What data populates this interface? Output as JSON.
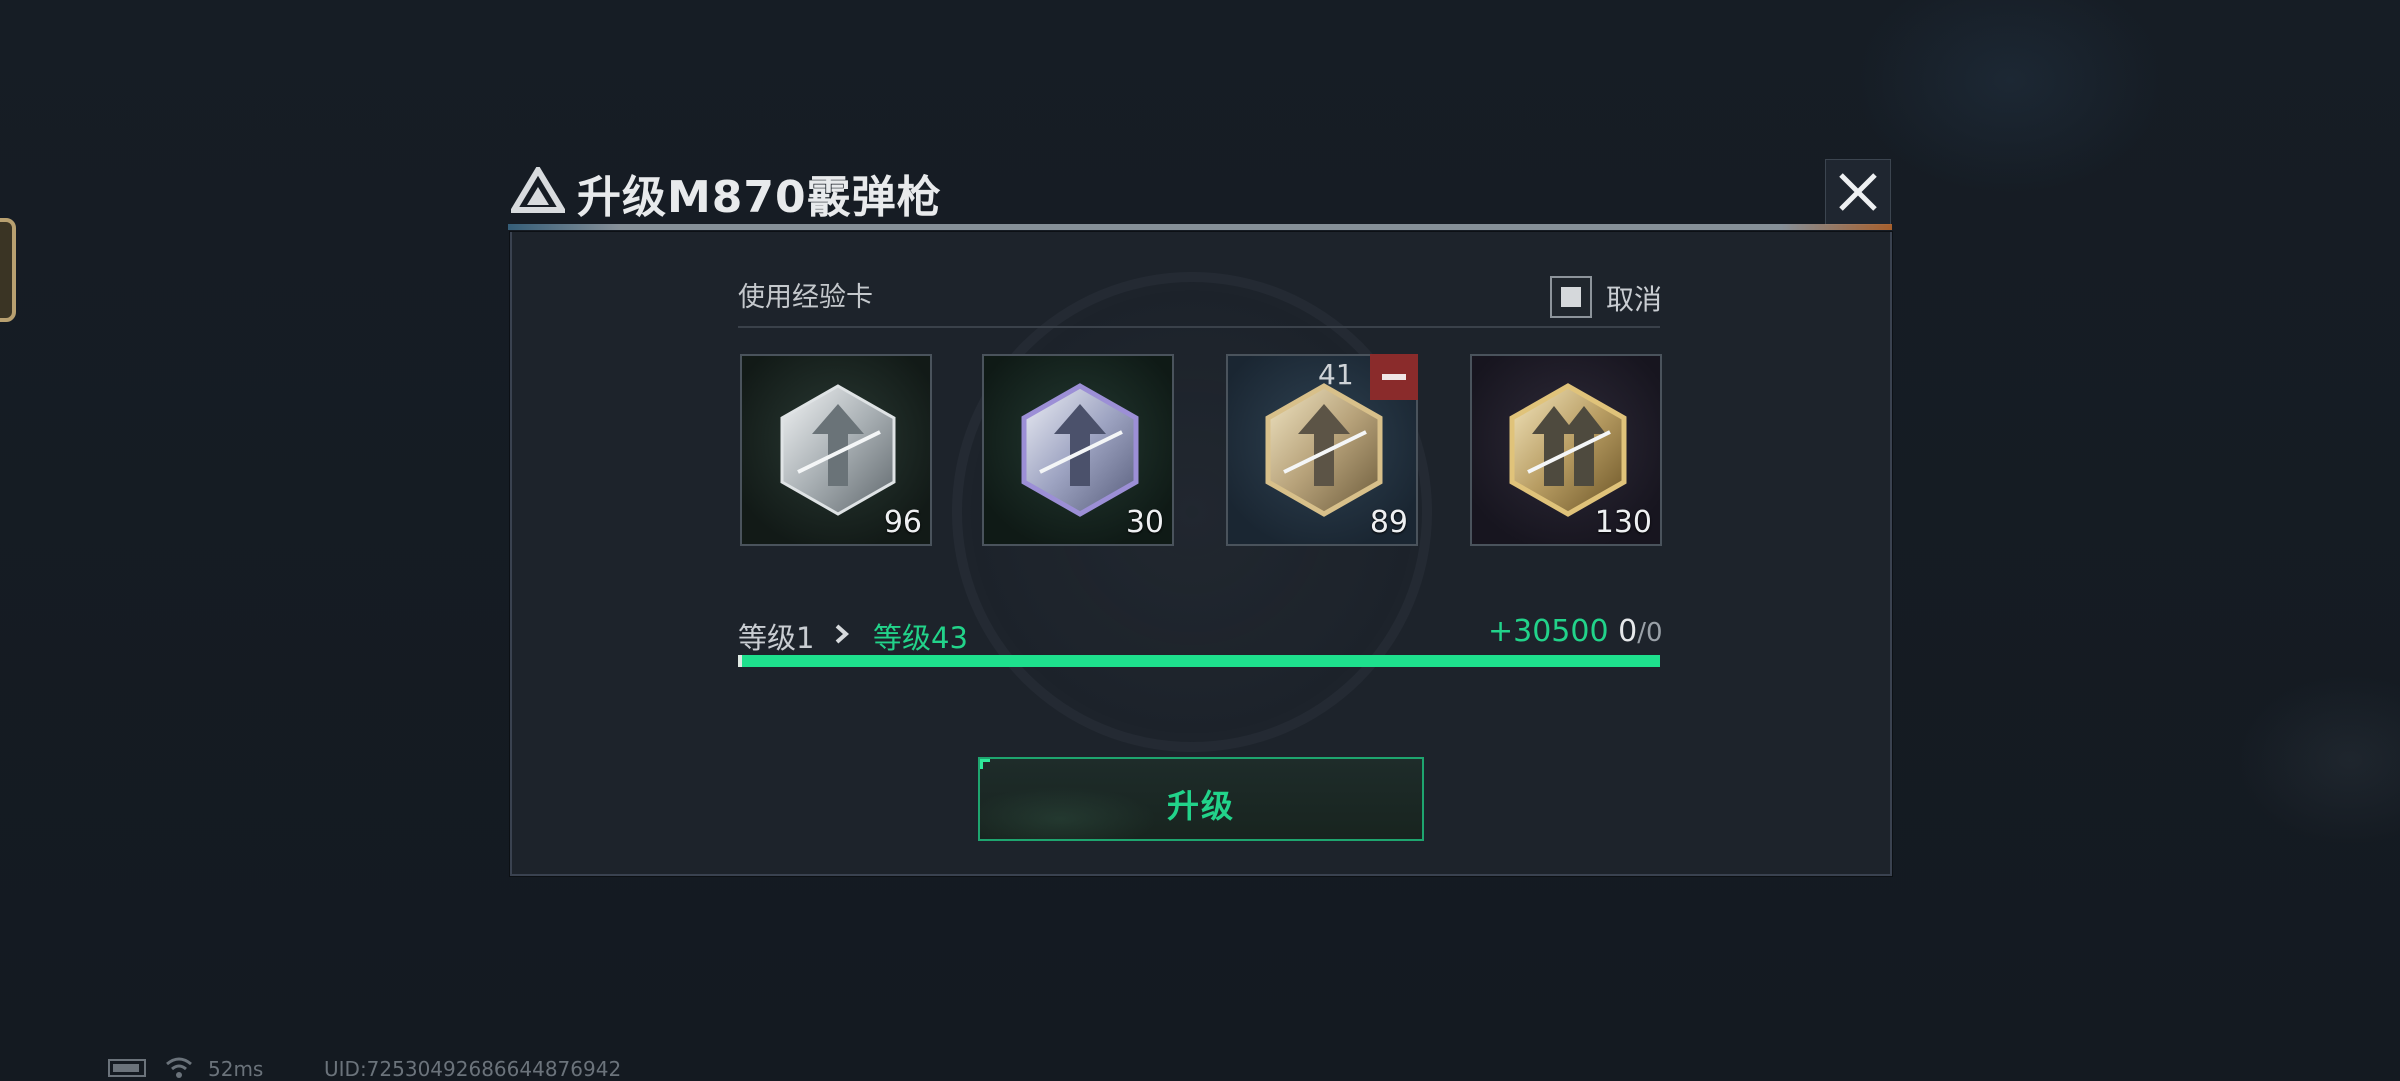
{
  "dialog": {
    "title": "升级M870霰弹枪",
    "close_icon": "close-icon",
    "title_icon": "triangle-emblem-icon"
  },
  "exp_cards": {
    "section_label": "使用经验卡",
    "cancel_label": "取消",
    "cancel_checked": true,
    "cards": [
      {
        "tier": "silver",
        "icon": "exp-card-silver-icon",
        "count": "96"
      },
      {
        "tier": "silver-purple",
        "icon": "exp-card-silver-purple-icon",
        "count": "30"
      },
      {
        "tier": "gold",
        "icon": "exp-card-gold-icon",
        "count": "89",
        "selected_count": "41"
      },
      {
        "tier": "gold-premium",
        "icon": "exp-card-gold-premium-icon",
        "count": "130"
      }
    ]
  },
  "level": {
    "from_label": "等级1",
    "to_label": "等级43",
    "xp_gain": "+30500",
    "xp_current": "0",
    "xp_separator": "/",
    "xp_max": "0",
    "progress_fraction": 1.0
  },
  "actions": {
    "upgrade_label": "升级"
  },
  "status_bar": {
    "ping": "52ms",
    "uid": "UID:7253049268664487694​2"
  },
  "colors": {
    "accent_green": "#22d38a",
    "minus_red": "#8a2b2b",
    "panel_bg": "#1d232b"
  }
}
